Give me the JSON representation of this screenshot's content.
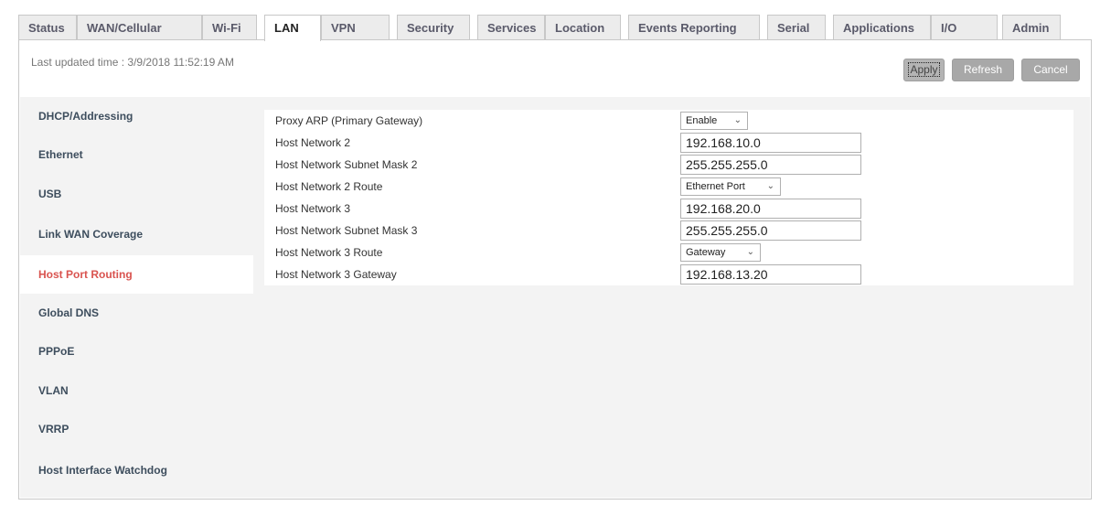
{
  "tabs": [
    {
      "label": "Status",
      "active": false
    },
    {
      "label": "WAN/Cellular",
      "active": false
    },
    {
      "label": "Wi-Fi",
      "active": false
    },
    {
      "label": "LAN",
      "active": true
    },
    {
      "label": "VPN",
      "active": false
    },
    {
      "label": "Security",
      "active": false
    },
    {
      "label": "Services",
      "active": false
    },
    {
      "label": "Location",
      "active": false
    },
    {
      "label": "Events Reporting",
      "active": false
    },
    {
      "label": "Serial",
      "active": false
    },
    {
      "label": "Applications",
      "active": false
    },
    {
      "label": "I/O",
      "active": false
    },
    {
      "label": "Admin",
      "active": false
    }
  ],
  "header": {
    "last_updated": "Last updated time : 3/9/2018 11:52:19 AM"
  },
  "actions": {
    "apply": "Apply",
    "refresh": "Refresh",
    "cancel": "Cancel"
  },
  "sidebar": {
    "items": [
      {
        "label": "DHCP/Addressing",
        "active": false
      },
      {
        "label": "Ethernet",
        "active": false
      },
      {
        "label": "USB",
        "active": false
      },
      {
        "label": "Link WAN Coverage",
        "active": false
      },
      {
        "label": "Host Port Routing",
        "active": true
      },
      {
        "label": "Global DNS",
        "active": false
      },
      {
        "label": "PPPoE",
        "active": false
      },
      {
        "label": "VLAN",
        "active": false
      },
      {
        "label": "VRRP",
        "active": false
      },
      {
        "label": "Host Interface Watchdog",
        "active": false
      }
    ]
  },
  "form": {
    "rows": [
      {
        "label": "Proxy ARP (Primary Gateway)",
        "type": "select",
        "value": "Enable"
      },
      {
        "label": "Host Network 2",
        "type": "input",
        "value": "192.168.10.0"
      },
      {
        "label": "Host Network Subnet Mask 2",
        "type": "input",
        "value": "255.255.255.0"
      },
      {
        "label": "Host Network 2 Route",
        "type": "select",
        "value": "Ethernet Port"
      },
      {
        "label": "Host Network 3",
        "type": "input",
        "value": "192.168.20.0"
      },
      {
        "label": "Host Network Subnet Mask 3",
        "type": "input",
        "value": "255.255.255.0"
      },
      {
        "label": "Host Network 3 Route",
        "type": "select",
        "value": "Gateway"
      },
      {
        "label": "Host Network 3 Gateway",
        "type": "input",
        "value": "192.168.13.20"
      }
    ]
  },
  "icons": {
    "select_chevron": "chevron-down-icon"
  },
  "colors": {
    "active_sidebar_text": "#d9534f",
    "button_bg": "#a8a8a8",
    "content_bg": "#f3f3f3"
  }
}
